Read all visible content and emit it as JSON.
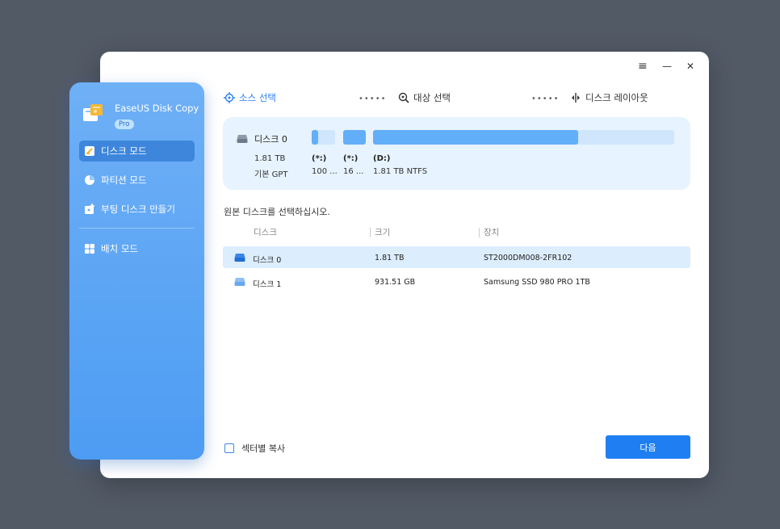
{
  "app": {
    "name": "EaseUS Disk Copy",
    "badge": "Pro"
  },
  "window_controls": {
    "menu": "≡",
    "minimize": "—",
    "close": "✕"
  },
  "sidebar": {
    "items": [
      {
        "label": "디스크 모드",
        "icon": "disk-mode-icon",
        "active": true
      },
      {
        "label": "파티션 모드",
        "icon": "partition-pie-icon",
        "active": false
      },
      {
        "label": "부팅 디스크 만들기",
        "icon": "bootable-disk-icon",
        "active": false
      },
      {
        "label": "배치 모드",
        "icon": "batch-grid-icon",
        "active": false
      }
    ]
  },
  "steps": {
    "source": "소스 선택",
    "target": "대상 선택",
    "layout": "디스크 레이아웃",
    "separator": "•••••"
  },
  "disk_panel": {
    "name": "디스크 0",
    "size": "1.81 TB",
    "type": "기본 GPT",
    "partitions": [
      {
        "label": "(*:)",
        "info": "100 ...",
        "used_fraction": 0.28
      },
      {
        "label": "(*:)",
        "info": "16 ...",
        "used_fraction": 1.0
      },
      {
        "label": "(D:)",
        "info": "1.81 TB NTFS",
        "used_fraction": 0.68
      }
    ]
  },
  "prompt": "원본 디스크를 선택하십시오.",
  "table": {
    "headers": [
      "디스크",
      "크기",
      "장치"
    ],
    "rows": [
      {
        "disk": "디스크 0",
        "size": "1.81 TB",
        "device": "ST2000DM008-2FR102",
        "selected": true
      },
      {
        "disk": "디스크 1",
        "size": "931.51 GB",
        "device": "Samsung SSD 980 PRO 1TB",
        "selected": false
      }
    ]
  },
  "sector_copy": {
    "label": "섹터별 복사",
    "checked": false
  },
  "next_button": "다음",
  "colors": {
    "accent": "#1f7ff2",
    "sidebar_top": "#6fb0f6",
    "sidebar_bottom": "#4d9cf3",
    "selected_row": "#dcedfd",
    "panel_bg": "#e7f3fe"
  }
}
